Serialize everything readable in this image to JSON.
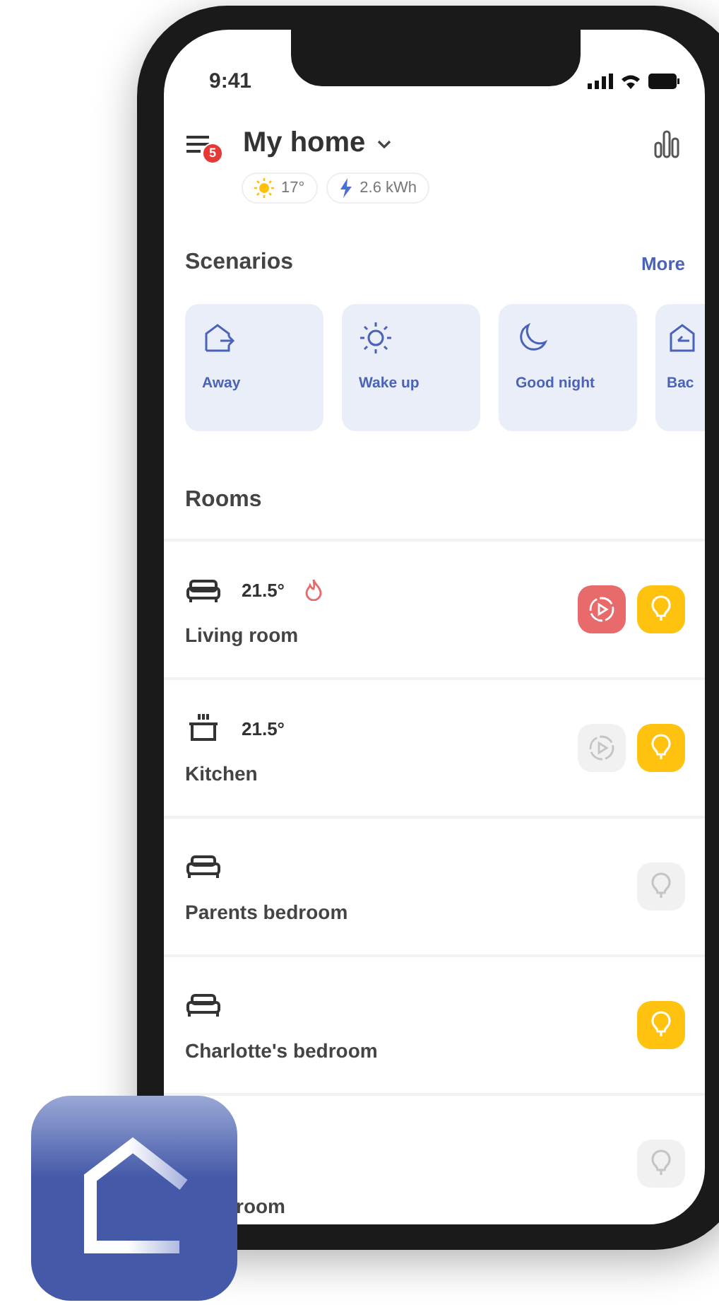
{
  "status_bar": {
    "time": "9:41"
  },
  "header": {
    "title": "My home",
    "notification_count": "5",
    "weather": "17°",
    "energy": "2.6 kWh"
  },
  "scenarios": {
    "title": "Scenarios",
    "more": "More",
    "items": [
      {
        "label": "Away",
        "kind": "leave"
      },
      {
        "label": "Wake up",
        "kind": "sun"
      },
      {
        "label": "Good night",
        "kind": "moon"
      },
      {
        "label": "Bac",
        "kind": "home"
      }
    ]
  },
  "rooms": {
    "title": "Rooms",
    "items": [
      {
        "name": "Living room",
        "kind": "sofa",
        "temperature": "21.5°",
        "heating": true,
        "covered": false,
        "controls": [
          {
            "kind": "media",
            "on": true
          },
          {
            "kind": "light",
            "on": true
          }
        ]
      },
      {
        "name": "Kitchen",
        "kind": "pot",
        "temperature": "21.5°",
        "heating": false,
        "covered": false,
        "controls": [
          {
            "kind": "media",
            "on": false
          },
          {
            "kind": "light",
            "on": true
          }
        ]
      },
      {
        "name": "Parents bedroom",
        "kind": "bed",
        "heating": false,
        "covered": false,
        "controls": [
          {
            "kind": "light",
            "on": false
          }
        ]
      },
      {
        "name": "Charlotte's bedroom",
        "kind": "bed",
        "heating": false,
        "covered": false,
        "controls": [
          {
            "kind": "light",
            "on": true
          }
        ]
      },
      {
        "name": "room",
        "heating": false,
        "covered": true,
        "controls": [
          {
            "kind": "light",
            "on": false
          }
        ]
      }
    ]
  }
}
